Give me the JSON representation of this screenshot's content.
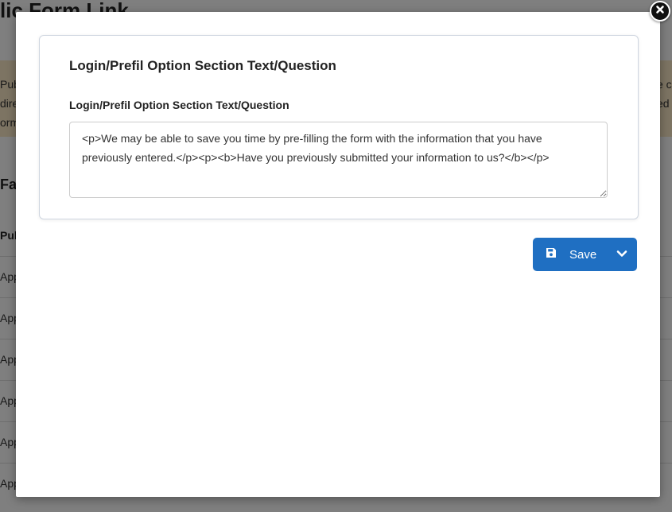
{
  "background": {
    "title": "lic Form Link",
    "banner_lines_left": [
      "Pub",
      "dire",
      "orm"
    ],
    "banner_lines_right": [
      "e c",
      "ed",
      ""
    ],
    "section_title": "Far",
    "table_header": "Pub",
    "row_text": [
      "App",
      "App",
      "App",
      "App",
      "App",
      "App"
    ]
  },
  "modal": {
    "card_title": "Login/Prefil Option Section Text/Question",
    "field_label": "Login/Prefil Option Section Text/Question",
    "field_value": "<p>We may be able to save you time by pre-filling the form with the information that you have previously entered.</p><p><b>Have you previously submitted your information to us?</b></p>",
    "save_label": "Save"
  },
  "icons": {
    "close": "close-icon",
    "save": "floppy-disk-icon",
    "dropdown": "chevron-down-icon"
  },
  "colors": {
    "primary": "#1f6fc2",
    "overlay": "rgba(0,0,0,0.5)",
    "banner": "#fbe9c7"
  }
}
